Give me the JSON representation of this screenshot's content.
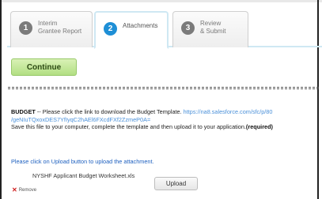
{
  "tabs": [
    {
      "number": "1",
      "line1": "Interim",
      "line2": "Grantee Report"
    },
    {
      "number": "2",
      "line1": "Attachments",
      "line2": ""
    },
    {
      "number": "3",
      "line1": "Review",
      "line2": "& Submit"
    }
  ],
  "continue_label": "Continue",
  "divider_text": "======================================================================================================",
  "budget": {
    "heading": "BUDGET",
    "instruction": " -- Please click the link to download the Budget Template. ",
    "link_part1": "https://na8.salesforce.com/sfc/p/80",
    "link_part2": "/geNIuTQxoxDES7YfIyqC2hAEl6FXcdFXf2ZzmeP0A=",
    "save_text": "Save this file to your computer, complete the template and then upload it to your application.",
    "required": "(required)"
  },
  "upload_note": "Please click on Upload button to upload the attachment.",
  "file_name": "NYSHF Applicant Budget Worksheet.xls",
  "upload_label": "Upload",
  "remove_label": "Remove",
  "colors": {
    "active_step": "#1e8fd6",
    "inactive_step": "#7b7b7b",
    "continue_bg": "#b2df83",
    "link": "#4a90d9",
    "note": "#1c5fbf",
    "remove_icon": "#d02020"
  }
}
